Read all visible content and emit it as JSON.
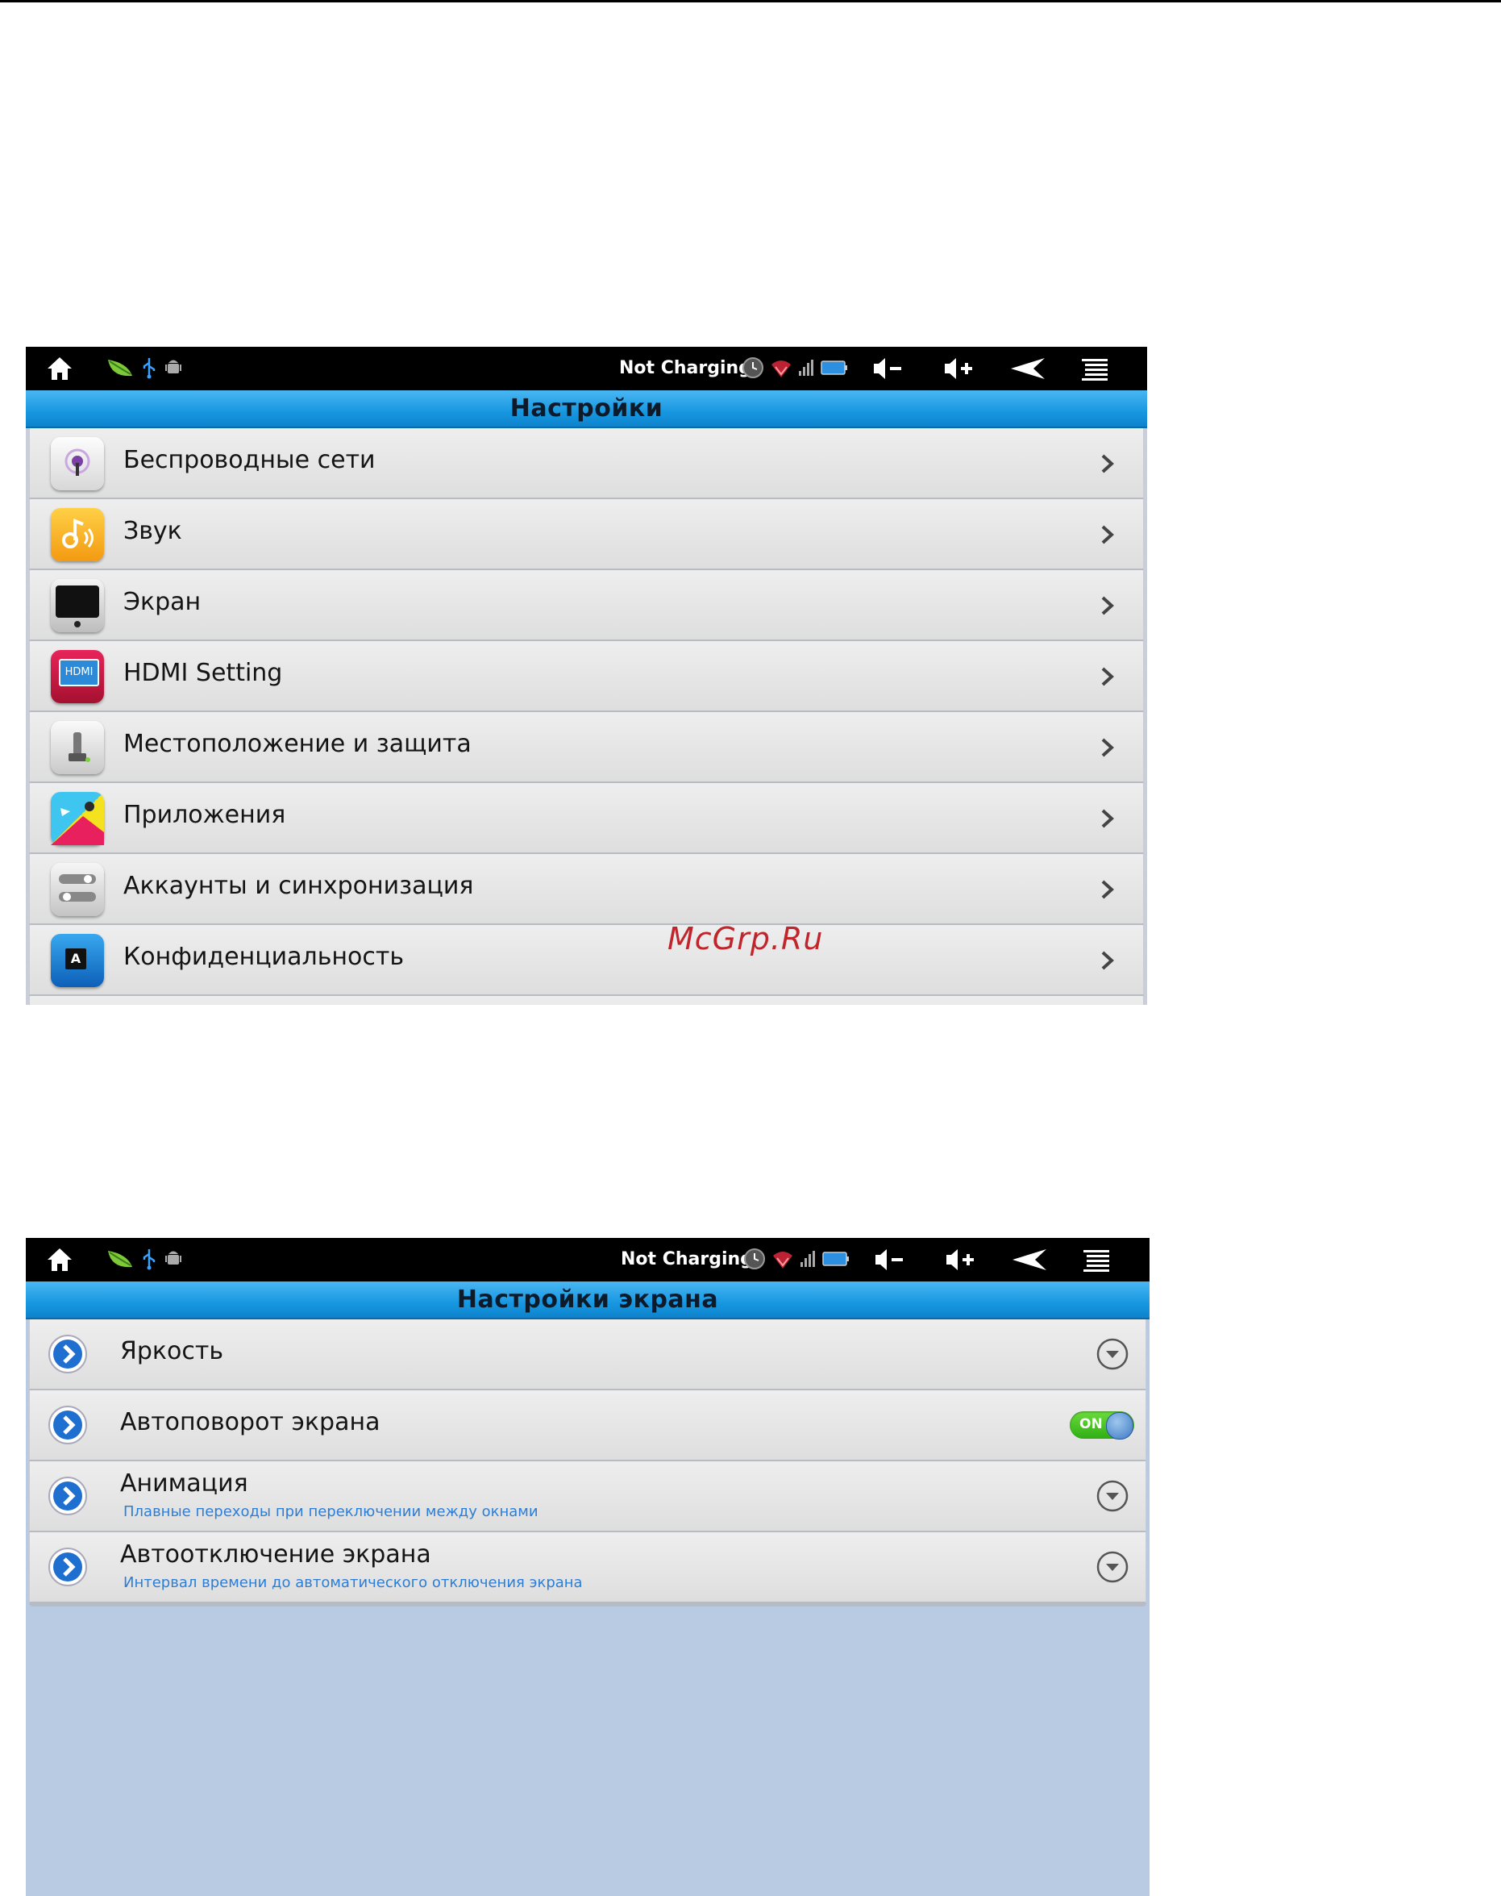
{
  "colors": {
    "title_bar": "#1797e1",
    "status_bar": "#000000",
    "row_bg": "#e6e6e6",
    "sublabel": "#2b7ed8",
    "toggle_on": "#2fae14",
    "empty_area": "#b9cbe2",
    "watermark": "#c0252b"
  },
  "status_bar": {
    "charging_text": "Not Charging",
    "left_icons": [
      "home-icon",
      "leaf-notification-icon",
      "usb-icon",
      "android-debug-icon"
    ],
    "tray_icons": [
      "clock-icon",
      "wifi-icon",
      "signal-icon",
      "battery-icon"
    ],
    "buttons": [
      "volume-down-icon",
      "volume-up-icon",
      "back-icon",
      "menu-icon"
    ]
  },
  "settings": {
    "title": "Настройки",
    "items": [
      {
        "label": "Беспроводные сети",
        "icon": "wireless-icon"
      },
      {
        "label": "Звук",
        "icon": "sound-icon"
      },
      {
        "label": "Экран",
        "icon": "display-icon"
      },
      {
        "label": "HDMI Setting",
        "icon": "hdmi-icon",
        "icon_text": "HDMI"
      },
      {
        "label": "Местоположение и защита",
        "icon": "location-security-icon"
      },
      {
        "label": "Приложения",
        "icon": "applications-icon"
      },
      {
        "label": "Аккаунты и синхронизация",
        "icon": "accounts-sync-icon"
      },
      {
        "label": "Конфиденциальность",
        "icon": "privacy-icon",
        "icon_text": "A"
      }
    ]
  },
  "display_settings": {
    "title": "Настройки экрана",
    "items": [
      {
        "label": "Яркость",
        "control": "dropdown"
      },
      {
        "label": "Автоповорот экрана",
        "control": "toggle",
        "toggle_text": "ON"
      },
      {
        "label": "Анимация",
        "sublabel": "Плавные переходы при переключении между окнами",
        "control": "dropdown"
      },
      {
        "label": "Автоотключение экрана",
        "sublabel": "Интервал времени до автоматического отключения экрана",
        "control": "dropdown"
      }
    ]
  },
  "watermark": "McGrp.Ru"
}
